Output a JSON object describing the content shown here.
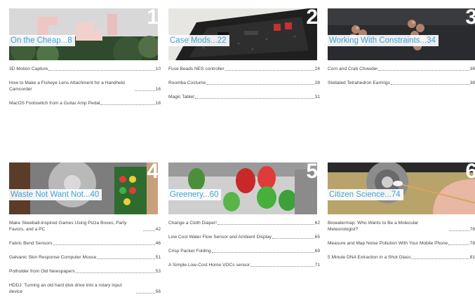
{
  "sections": [
    {
      "title": "On the Cheap...8",
      "number": "1",
      "entries": [
        {
          "title": "3D Motion Capture",
          "page": "10"
        },
        {
          "title": "How to Make a Fisheye Lens Attachment for a Handheld Camcorder",
          "page": "16"
        },
        {
          "title": "MacOS Footswitch from a Guitar Amp Pedal",
          "page": "18"
        }
      ]
    },
    {
      "title": "Case Mods...22",
      "number": "2",
      "entries": [
        {
          "title": "Fuse Beads NES controller",
          "page": "24"
        },
        {
          "title": "Roomba Costume",
          "page": "28"
        },
        {
          "title": "Magic Tablet",
          "page": "31"
        }
      ]
    },
    {
      "title": "Working With Constraints...34",
      "number": "3",
      "entries": [
        {
          "title": "Corn and Crab Chowder",
          "page": "36"
        },
        {
          "title": "Stellated Tetrahedron Earrings",
          "page": "38"
        }
      ]
    },
    {
      "title": "Waste Not Want Not...40",
      "number": "4",
      "entries": [
        {
          "title": "Make Skeeball-inspired Games Using Pizza Boxes, Party Favors, and a PC",
          "page": "42"
        },
        {
          "title": "Fabric Bend Sensors",
          "page": "46"
        },
        {
          "title": "Galvanic Skin Response Computer Mouse",
          "page": "51"
        },
        {
          "title": "Potholder from Old Newspapers",
          "page": "53"
        },
        {
          "title": "HDDJ: Turning an old hard disk drive into a rotary input device",
          "page": "56"
        }
      ]
    },
    {
      "title": "Greenery...60",
      "number": "5",
      "entries": [
        {
          "title": "Change a Cloth Diaper!",
          "page": "62"
        },
        {
          "title": "Low Cost Water Flow Sensor and Ambient Display",
          "page": "65"
        },
        {
          "title": "Crisp Packet Folding",
          "page": "69"
        },
        {
          "title": "A Simple Low-Cost Home VOCs sensor",
          "page": "71"
        }
      ]
    },
    {
      "title": "Citizen Science...74",
      "number": "6",
      "entries": [
        {
          "title": "Biowatermap: Who Wants to Be a Molecular Meteorologist?",
          "page": "76"
        },
        {
          "title": "Measure and Map Noise Pollution With Your Mobile Phone",
          "page": "78"
        },
        {
          "title": "5 Minute DNA Extraction in a Shot Glass",
          "page": "81"
        }
      ]
    }
  ]
}
